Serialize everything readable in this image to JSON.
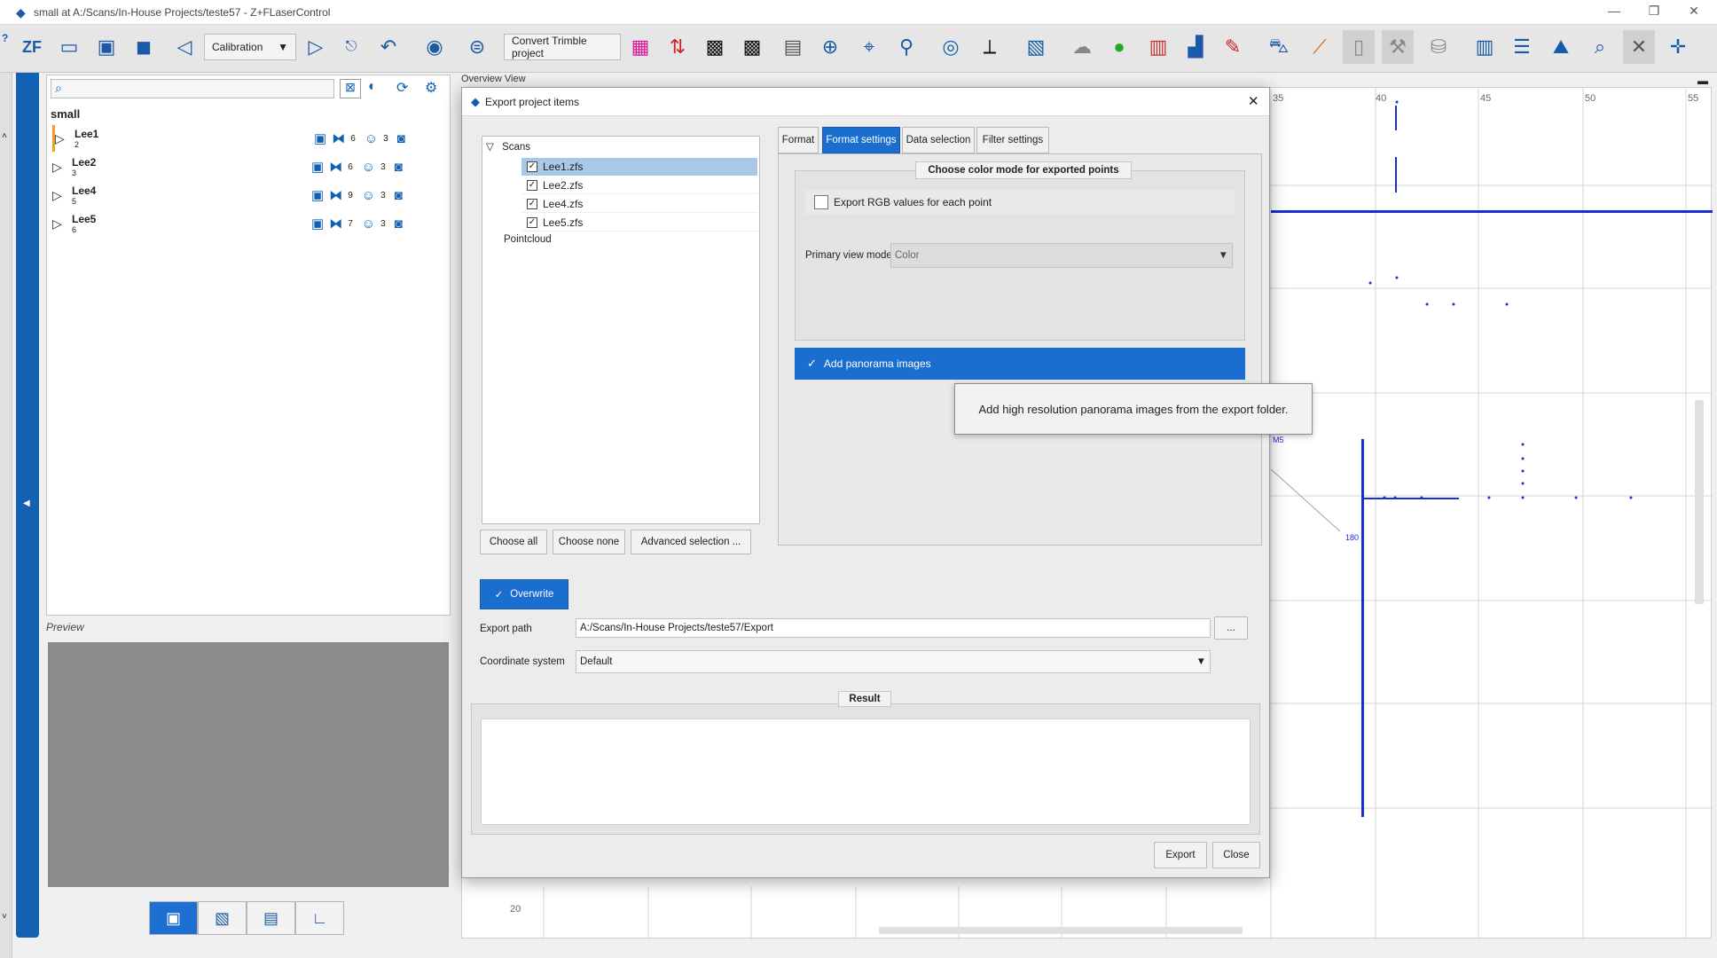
{
  "window": {
    "title": "small at A:/Scans/In-House Projects/teste57 - Z+FLaserControl"
  },
  "toolbar": {
    "dropdown_value": "Calibration",
    "convert_label": "Convert Trimble project"
  },
  "project": {
    "name": "small",
    "scans": [
      {
        "name": "Lee1",
        "num": "2",
        "count1": "6",
        "count2": "3"
      },
      {
        "name": "Lee2",
        "num": "3",
        "count1": "6",
        "count2": "3"
      },
      {
        "name": "Lee4",
        "num": "5",
        "count1": "9",
        "count2": "3"
      },
      {
        "name": "Lee5",
        "num": "6",
        "count1": "7",
        "count2": "3"
      }
    ]
  },
  "preview": {
    "label": "Preview"
  },
  "overview": {
    "label": "Overview View",
    "ticks": [
      "35",
      "40",
      "45",
      "50",
      "55"
    ],
    "bottom_tick": "20",
    "marker_label": "M5",
    "marker2_label": "180"
  },
  "dialog": {
    "title": "Export project items",
    "tree": {
      "root": "Scans",
      "items": [
        "Lee1.zfs",
        "Lee2.zfs",
        "Lee4.zfs",
        "Lee5.zfs"
      ],
      "pointcloud": "Pointcloud"
    },
    "buttons": {
      "choose_all": "Choose all",
      "choose_none": "Choose none",
      "advanced": "Advanced selection ...",
      "overwrite": "Overwrite",
      "browse": "...",
      "export": "Export",
      "close": "Close"
    },
    "tabs": [
      "Format",
      "Format settings",
      "Data selection",
      "Filter settings"
    ],
    "format_settings": {
      "group_title": "Choose color mode for exported points",
      "rgb_label": "Export RGB values for each point",
      "primary_label": "Primary view mode",
      "primary_value": "Color",
      "panorama_label": "Add panorama images"
    },
    "export_path": {
      "label": "Export path",
      "value": "A:/Scans/In-House Projects/teste57/Export"
    },
    "coordinate": {
      "label": "Coordinate system",
      "value": "Default"
    },
    "result": {
      "title": "Result"
    }
  },
  "tooltip": {
    "text": "Add high resolution panorama images from the export folder."
  }
}
